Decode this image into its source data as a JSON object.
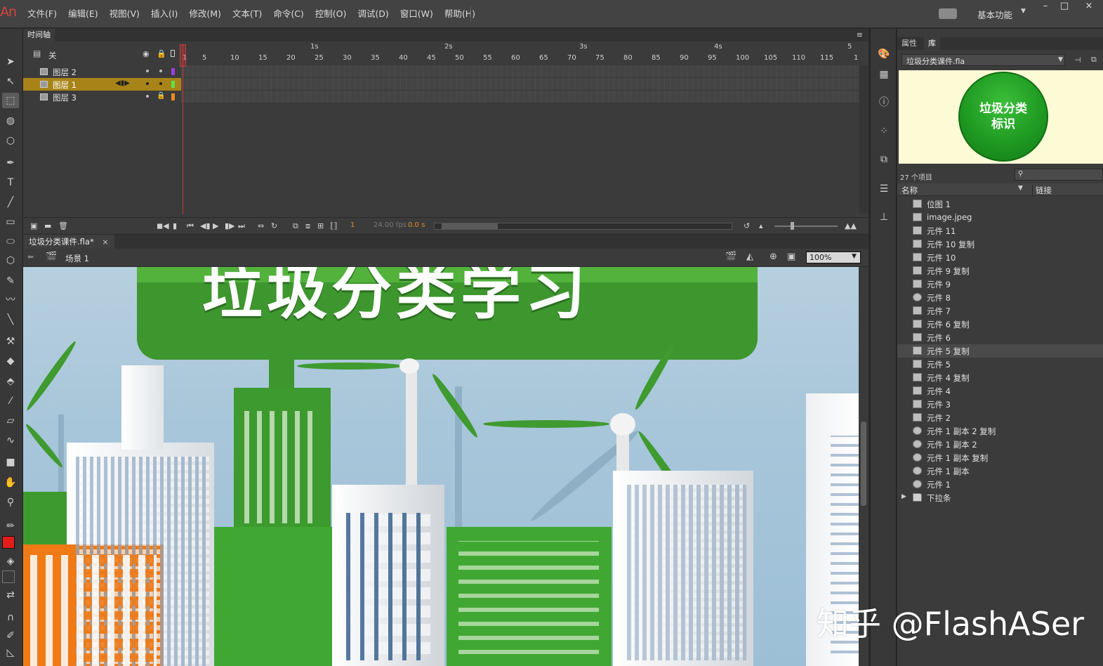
{
  "app": {
    "logo": "An",
    "menu": [
      "文件(F)",
      "编辑(E)",
      "视图(V)",
      "插入(I)",
      "修改(M)",
      "文本(T)",
      "命令(C)",
      "控制(O)",
      "调试(D)",
      "窗口(W)",
      "帮助(H)"
    ],
    "workspace": "基本功能",
    "window_controls": [
      "–",
      "□",
      "×"
    ]
  },
  "timeline": {
    "panel_title": "时间轴",
    "layers_header_label": "关",
    "ruler_seconds": [
      "1s",
      "2s",
      "3s",
      "4s",
      "5"
    ],
    "ruler_frames": [
      "1",
      "5",
      "10",
      "15",
      "20",
      "25",
      "30",
      "35",
      "40",
      "45",
      "50",
      "55",
      "60",
      "65",
      "70",
      "75",
      "80",
      "85",
      "90",
      "95",
      "100",
      "105",
      "110",
      "115",
      "1"
    ],
    "layers": [
      {
        "name": "图层 2",
        "color": "#9b3fd6",
        "selected": false,
        "locked": false
      },
      {
        "name": "图层 1",
        "color": "#5fe04a",
        "selected": true,
        "locked": false
      },
      {
        "name": "图层 3",
        "color": "#f08a1c",
        "selected": false,
        "locked": true
      }
    ],
    "current_frame": "1",
    "fps": "24.00 fps",
    "elapsed": "0.0 s"
  },
  "document": {
    "tab_title": "垃圾分类课件.fla*",
    "tab_close": "×",
    "scene": "场景 1",
    "zoom": "100%"
  },
  "stage": {
    "title": "垃圾分类学习",
    "colors": {
      "banner": "#3d962e",
      "sky": "#a8c6da",
      "orange": "#f07a16"
    }
  },
  "library": {
    "tabs": [
      "属性",
      "库"
    ],
    "document": "垃圾分类课件.fla",
    "preview_text_line1": "垃圾分类",
    "preview_text_line2": "标识",
    "count": "27 个项目",
    "col_name": "名称",
    "col_link": "链接",
    "items": [
      {
        "label": "位图 1",
        "kind": "bitmap"
      },
      {
        "label": "image.jpeg",
        "kind": "bitmap"
      },
      {
        "label": "元件 11",
        "kind": "graphic"
      },
      {
        "label": "元件 10 复制",
        "kind": "graphic"
      },
      {
        "label": "元件 10",
        "kind": "graphic"
      },
      {
        "label": "元件 9 复制",
        "kind": "graphic"
      },
      {
        "label": "元件 9",
        "kind": "graphic"
      },
      {
        "label": "元件 8",
        "kind": "button"
      },
      {
        "label": "元件 7",
        "kind": "graphic"
      },
      {
        "label": "元件 6 复制",
        "kind": "graphic"
      },
      {
        "label": "元件 6",
        "kind": "graphic"
      },
      {
        "label": "元件 5 复制",
        "kind": "graphic",
        "selected": true
      },
      {
        "label": "元件 5",
        "kind": "graphic"
      },
      {
        "label": "元件 4 复制",
        "kind": "graphic"
      },
      {
        "label": "元件 4",
        "kind": "graphic"
      },
      {
        "label": "元件 3",
        "kind": "graphic"
      },
      {
        "label": "元件 2",
        "kind": "graphic"
      },
      {
        "label": "元件 1 副本 2 复制",
        "kind": "button"
      },
      {
        "label": "元件 1 副本 2",
        "kind": "button"
      },
      {
        "label": "元件 1 副本 复制",
        "kind": "button"
      },
      {
        "label": "元件 1 副本",
        "kind": "button"
      },
      {
        "label": "元件 1",
        "kind": "button"
      },
      {
        "label": "下拉条",
        "kind": "folder"
      }
    ]
  },
  "watermark": "知乎 @FlashASer"
}
